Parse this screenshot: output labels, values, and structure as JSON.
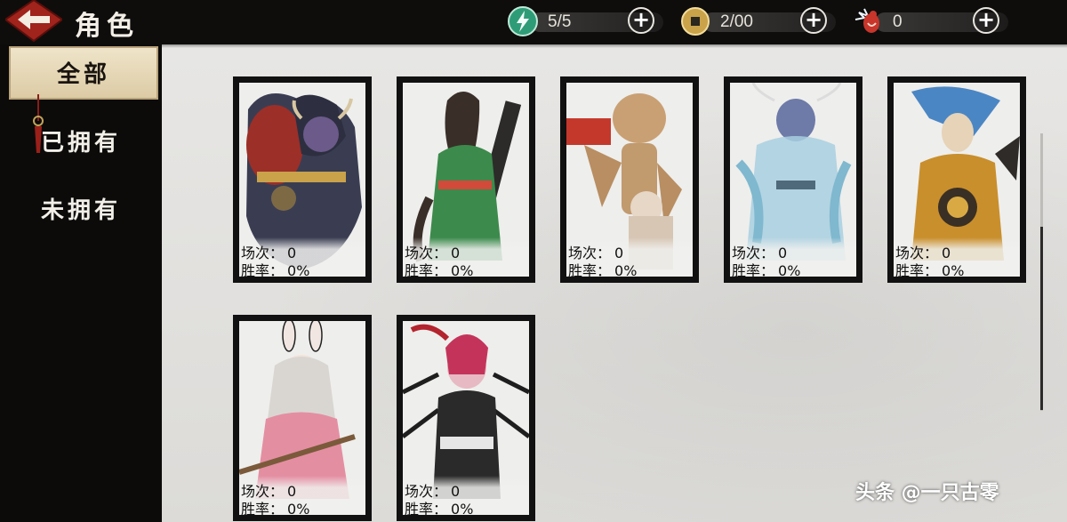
{
  "header": {
    "title": "角色",
    "back_icon": "back-arrow-icon"
  },
  "resources": [
    {
      "icon": "energy-lightning-icon",
      "value": "5/5",
      "color": "#3fb58a"
    },
    {
      "icon": "coin-icon",
      "value": "2/00",
      "color": "#d6b35a"
    },
    {
      "icon": "red-gourd-icon",
      "value": "0",
      "color": "#c8352b"
    }
  ],
  "sidebar": {
    "tabs": [
      {
        "label": "全部",
        "active": true
      },
      {
        "label": "已拥有",
        "active": false
      },
      {
        "label": "未拥有",
        "active": false
      }
    ]
  },
  "stats_labels": {
    "matches": "场次：",
    "winrate": "胜率：",
    "matches_prefix": "场次",
    "winrate_prefix": "胜率"
  },
  "characters": [
    {
      "portrait": "bull-demon-icon",
      "matches": "0",
      "winrate": "0%"
    },
    {
      "portrait": "swordswoman-icon",
      "matches": "0",
      "winrate": "0%"
    },
    {
      "portrait": "puppet-monk-icon",
      "matches": "0",
      "winrate": "0%"
    },
    {
      "portrait": "spirit-dancer-icon",
      "matches": "0",
      "winrate": "0%"
    },
    {
      "portrait": "golden-warrior-icon",
      "matches": "0",
      "winrate": "0%"
    },
    {
      "portrait": "rabbit-girl-icon",
      "matches": "0",
      "winrate": "0%"
    },
    {
      "portrait": "spider-woman-icon",
      "matches": "0",
      "winrate": "0%"
    }
  ],
  "watermark": "头条 @一只古零"
}
